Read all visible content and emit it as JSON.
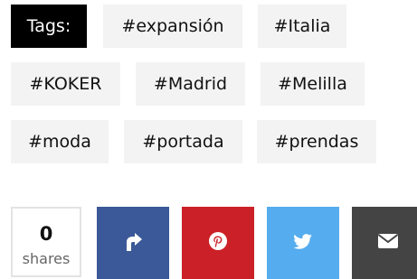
{
  "tags": {
    "label": "Tags:",
    "items": [
      {
        "text": "#expansión"
      },
      {
        "text": "#Italia"
      },
      {
        "text": "#KOKER"
      },
      {
        "text": "#Madrid"
      },
      {
        "text": "#Melilla"
      },
      {
        "text": "#moda"
      },
      {
        "text": "#portada"
      },
      {
        "text": "#prendas"
      }
    ]
  },
  "share": {
    "count": "0",
    "count_label": "shares",
    "buttons": [
      {
        "icon": "facebook-icon",
        "color": "#3b5998"
      },
      {
        "icon": "pinterest-icon",
        "color": "#cb2027"
      },
      {
        "icon": "twitter-icon",
        "color": "#55acee"
      },
      {
        "icon": "email-icon",
        "color": "#444444"
      }
    ]
  }
}
